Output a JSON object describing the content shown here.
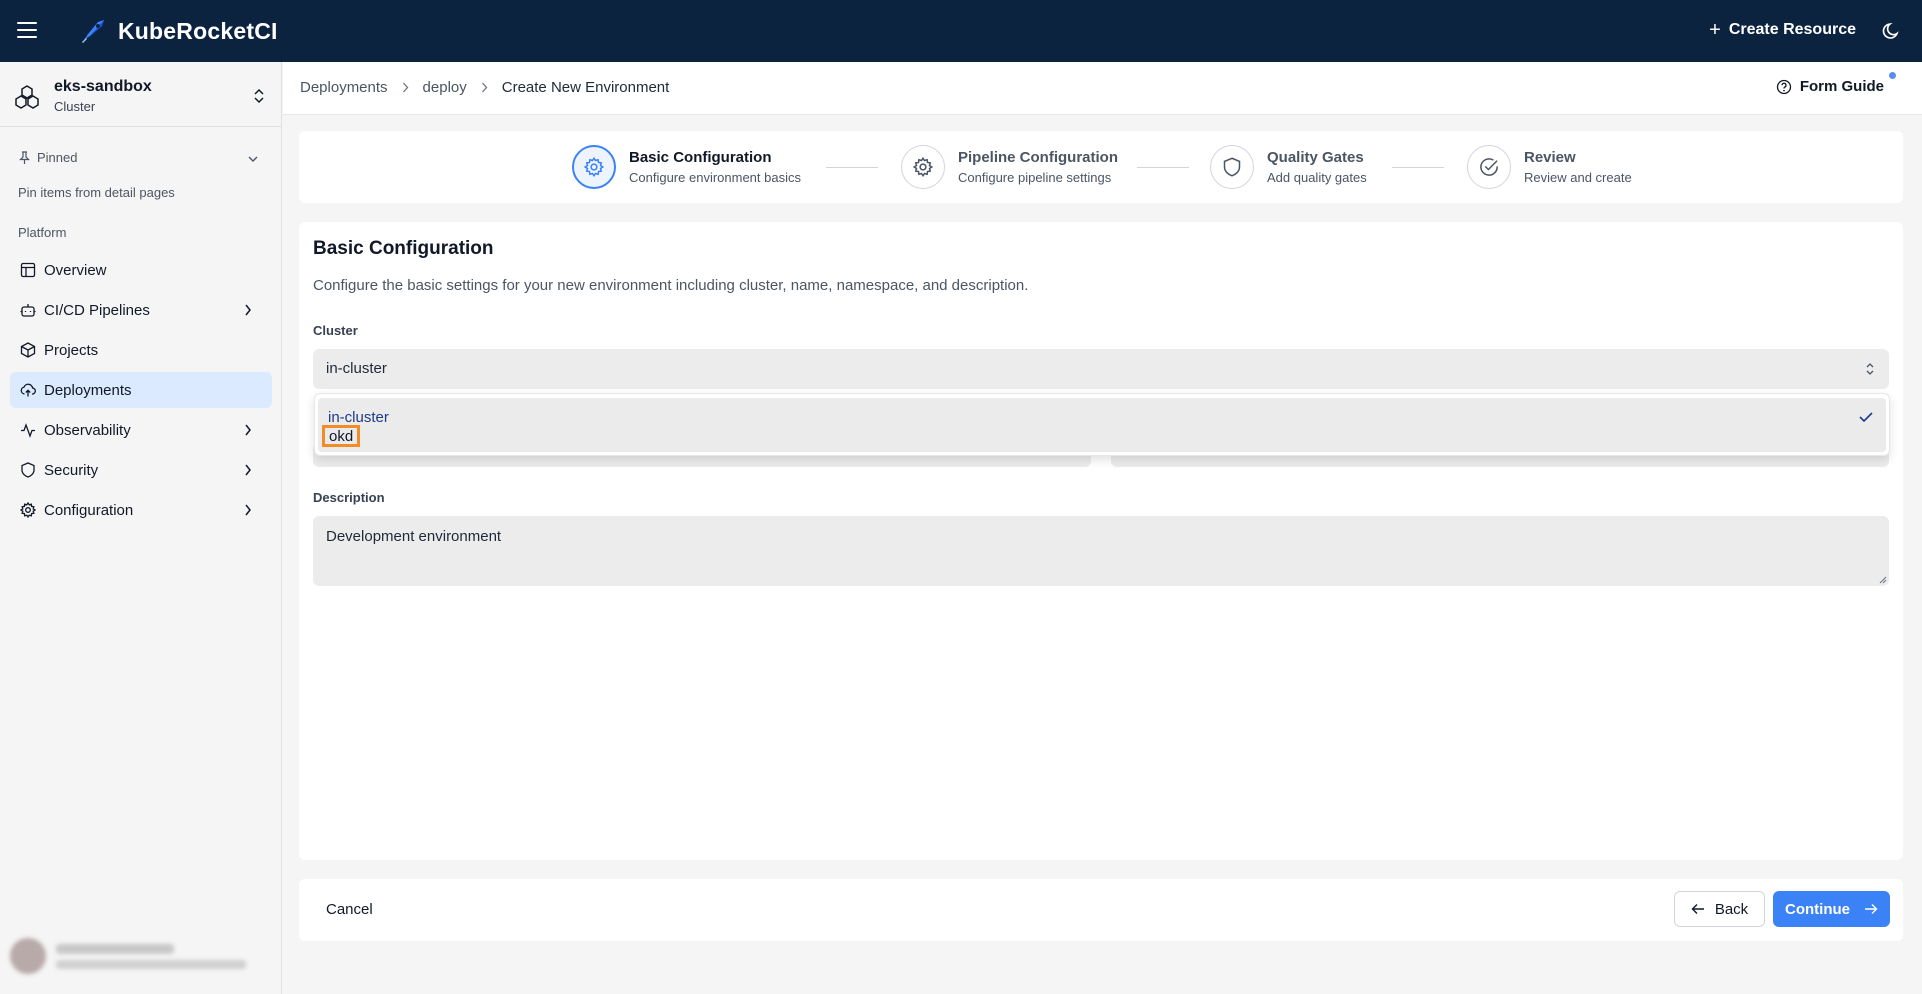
{
  "app": {
    "name": "KubeRocketCI"
  },
  "topbar": {
    "create_resource_label": "Create Resource"
  },
  "cluster": {
    "name": "eks-sandbox",
    "type": "Cluster"
  },
  "sidebar": {
    "pinned_label": "Pinned",
    "pinned_hint": "Pin items from detail pages",
    "section_label": "Platform",
    "items": [
      {
        "label": "Overview",
        "icon": "layout-icon",
        "has_children": false
      },
      {
        "label": "CI/CD Pipelines",
        "icon": "bot-icon",
        "has_children": true
      },
      {
        "label": "Projects",
        "icon": "box-icon",
        "has_children": false
      },
      {
        "label": "Deployments",
        "icon": "cloud-upload-icon",
        "has_children": false,
        "active": true
      },
      {
        "label": "Observability",
        "icon": "activity-icon",
        "has_children": true
      },
      {
        "label": "Security",
        "icon": "shield-icon",
        "has_children": true
      },
      {
        "label": "Configuration",
        "icon": "gear-icon",
        "has_children": true
      }
    ]
  },
  "breadcrumb": {
    "items": [
      "Deployments",
      "deploy"
    ],
    "current": "Create New Environment"
  },
  "header": {
    "form_guide_label": "Form Guide"
  },
  "stepper": {
    "steps": [
      {
        "title": "Basic Configuration",
        "subtitle": "Configure environment basics",
        "icon": "gear-icon",
        "active": true
      },
      {
        "title": "Pipeline Configuration",
        "subtitle": "Configure pipeline settings",
        "icon": "gear-icon",
        "active": false
      },
      {
        "title": "Quality Gates",
        "subtitle": "Add quality gates",
        "icon": "shield-icon",
        "active": false
      },
      {
        "title": "Review",
        "subtitle": "Review and create",
        "icon": "check-circle-icon",
        "active": false
      }
    ]
  },
  "form": {
    "title": "Basic Configuration",
    "description": "Configure the basic settings for your new environment including cluster, name, namespace, and description.",
    "cluster_label": "Cluster",
    "cluster_value": "in-cluster",
    "cluster_options": [
      "in-cluster",
      "okd"
    ],
    "description_label": "Description",
    "description_value": "Development environment"
  },
  "footer": {
    "cancel_label": "Cancel",
    "back_label": "Back",
    "continue_label": "Continue"
  },
  "colors": {
    "topbar_bg": "#0c2340",
    "accent": "#3b82f6",
    "highlight": "#f28c28",
    "active_nav_bg": "#dbeafe"
  }
}
